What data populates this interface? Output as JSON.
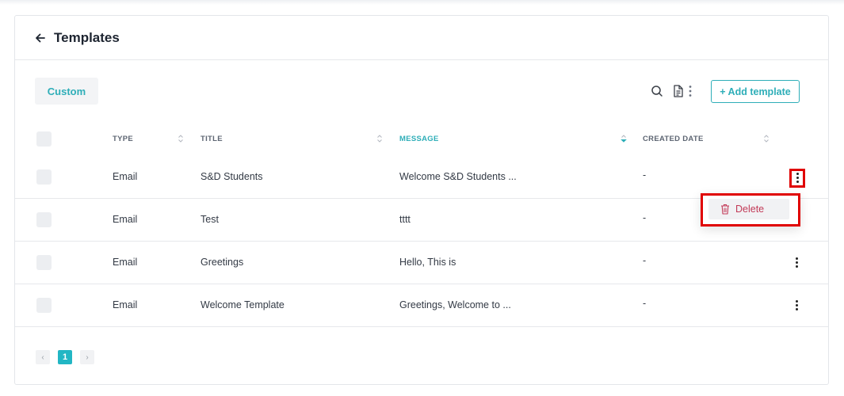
{
  "header": {
    "title": "Templates"
  },
  "tabs": [
    {
      "label": "Custom"
    }
  ],
  "toolbar": {
    "add_label": "+ Add template"
  },
  "table": {
    "columns": [
      "TYPE",
      "TITLE",
      "MESSAGE",
      "CREATED DATE"
    ],
    "rows": [
      {
        "type": "Email",
        "title": "S&D Students",
        "message": "Welcome S&D Students ...",
        "created": "-"
      },
      {
        "type": "Email",
        "title": "Test",
        "message": "tttt",
        "created": "-"
      },
      {
        "type": "Email",
        "title": "Greetings",
        "message": "Hello, This is",
        "created": "-"
      },
      {
        "type": "Email",
        "title": "Welcome Template",
        "message": "Greetings, Welcome to ...",
        "created": "-"
      }
    ]
  },
  "row_menu": {
    "delete_label": "Delete"
  },
  "pagination": {
    "prev": "‹",
    "current": "1",
    "next": "›"
  },
  "colors": {
    "accent": "#2eaeb8",
    "danger": "#c23a57",
    "highlight": "#e00000"
  },
  "icons": [
    "back-arrow-icon",
    "search-icon",
    "export-icon",
    "more-vertical-icon",
    "sort-icon",
    "trash-icon"
  ]
}
